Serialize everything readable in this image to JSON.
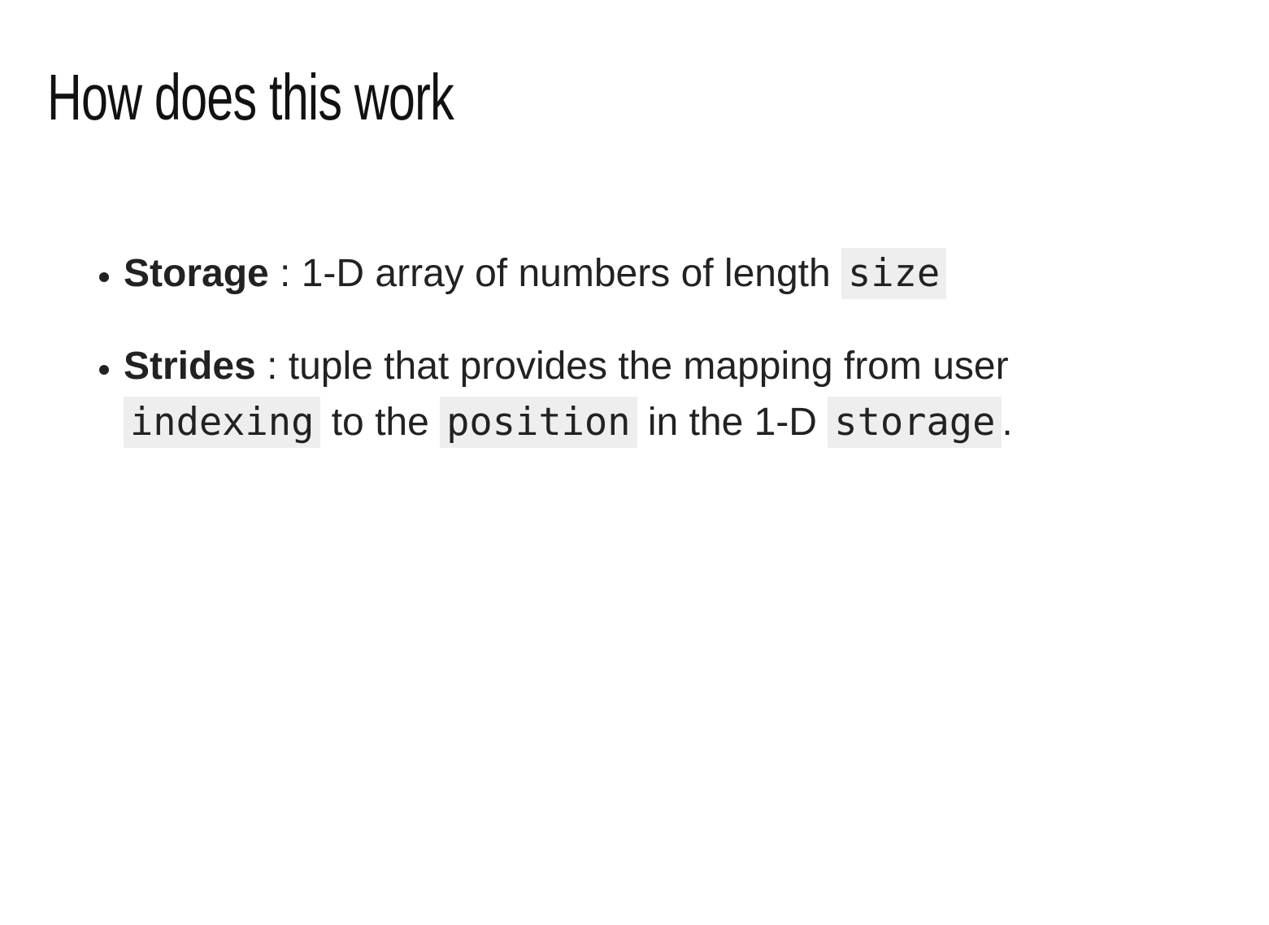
{
  "slide": {
    "title": "How does this work",
    "items": [
      {
        "term": "Storage",
        "sep": " : ",
        "text1": "1-D array of numbers of length ",
        "code1": "size"
      },
      {
        "term": "Strides",
        "sep": " : ",
        "text1": "tuple that provides the mapping from user ",
        "code1": "indexing",
        "text2": " to the ",
        "code2": "position",
        "text3": " in the 1-D ",
        "code3": "storage",
        "text4": "."
      }
    ]
  }
}
